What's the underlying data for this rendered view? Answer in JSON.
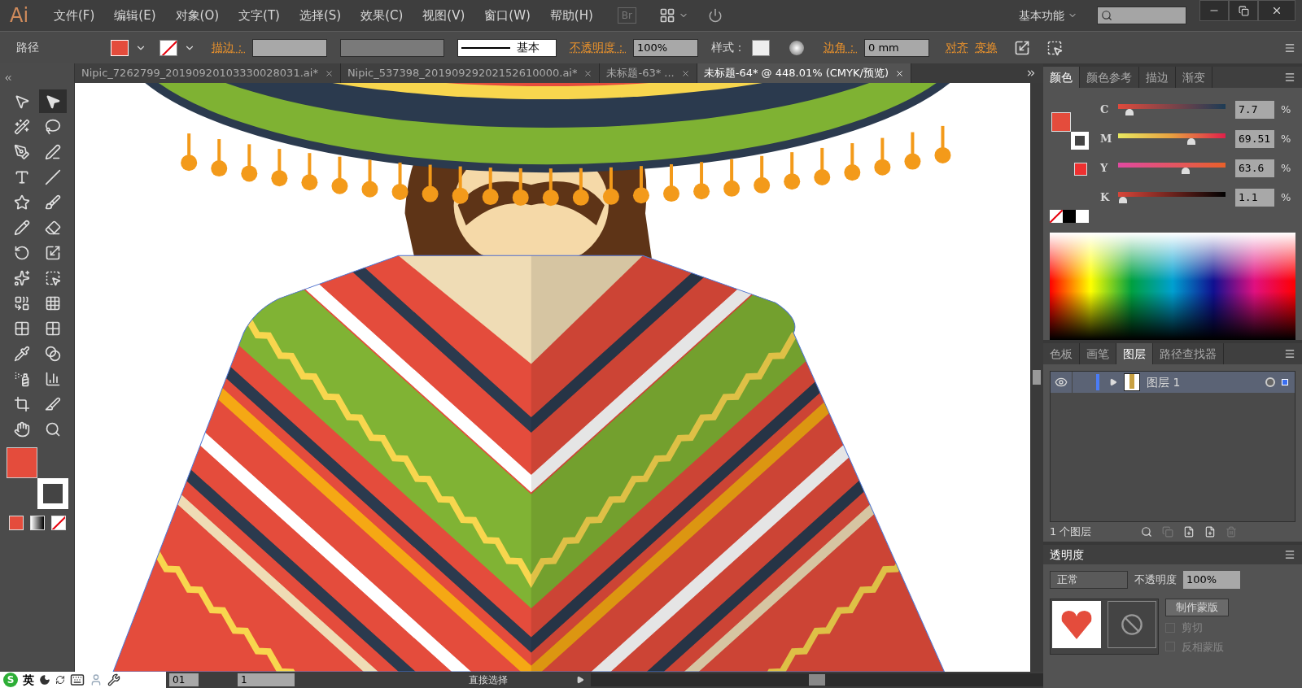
{
  "app_logo": "Ai",
  "menu": [
    "文件(F)",
    "编辑(E)",
    "对象(O)",
    "文字(T)",
    "选择(S)",
    "效果(C)",
    "视图(V)",
    "窗口(W)",
    "帮助(H)"
  ],
  "bridge_label": "Br",
  "workspace": "基本功能",
  "control_bar": {
    "object_type": "路径",
    "stroke_label": "描边：",
    "stroke_style": "基本",
    "opacity_label": "不透明度：",
    "opacity": "100%",
    "style_label": "样式：",
    "corner_label": "边角：",
    "corner_value": "0 mm",
    "align": "对齐",
    "transform": "变换"
  },
  "tabs": [
    {
      "label": "Nipic_7262799_20190920103330028031.ai*",
      "selected": false
    },
    {
      "label": "Nipic_537398_20190929202152610000.ai*",
      "selected": false
    },
    {
      "label": "未标题-63* ...",
      "selected": false
    },
    {
      "label": "未标题-64* @ 448.01% (CMYK/预览)",
      "selected": true
    }
  ],
  "tools": [
    {
      "kind": "select",
      "selected": false
    },
    {
      "kind": "direct",
      "selected": true
    },
    {
      "kind": "wand",
      "selected": false
    },
    {
      "kind": "lasso",
      "selected": false
    },
    {
      "kind": "pen",
      "selected": false
    },
    {
      "kind": "curvature",
      "selected": false
    },
    {
      "kind": "type",
      "selected": false
    },
    {
      "kind": "line",
      "selected": false
    },
    {
      "kind": "star",
      "selected": false
    },
    {
      "kind": "brush",
      "selected": false
    },
    {
      "kind": "pencil",
      "selected": false
    },
    {
      "kind": "eraser",
      "selected": false
    },
    {
      "kind": "rotate",
      "selected": false
    },
    {
      "kind": "scale",
      "selected": false
    },
    {
      "kind": "warp",
      "selected": false
    },
    {
      "kind": "freetransform",
      "selected": false
    },
    {
      "kind": "shapebuilder",
      "selected": false
    },
    {
      "kind": "perspective",
      "selected": false
    },
    {
      "kind": "mesh",
      "selected": false
    },
    {
      "kind": "gradient",
      "selected": false
    },
    {
      "kind": "eyedropper",
      "selected": false
    },
    {
      "kind": "blend",
      "selected": false
    },
    {
      "kind": "spray",
      "selected": false
    },
    {
      "kind": "graph",
      "selected": false
    },
    {
      "kind": "artboard",
      "selected": false
    },
    {
      "kind": "slice",
      "selected": false
    },
    {
      "kind": "hand",
      "selected": false
    },
    {
      "kind": "zoom",
      "selected": false
    }
  ],
  "color_panel": {
    "tabs": [
      {
        "label": "颜色",
        "selected": true
      },
      {
        "label": "颜色参考",
        "selected": false
      },
      {
        "label": "描边",
        "selected": false
      },
      {
        "label": "渐变",
        "selected": false
      }
    ],
    "channels": [
      {
        "name": "C",
        "value": "7.7",
        "unit": "%",
        "level": 0.077
      },
      {
        "name": "M",
        "value": "69.51",
        "unit": "%",
        "level": 0.6951
      },
      {
        "name": "Y",
        "value": "63.6",
        "unit": "%",
        "level": 0.6365
      },
      {
        "name": "K",
        "value": "1.1",
        "unit": "%",
        "level": 0.011
      }
    ]
  },
  "layers_panel": {
    "tabs": [
      {
        "label": "色板",
        "selected": false
      },
      {
        "label": "画笔",
        "selected": false
      },
      {
        "label": "图层",
        "selected": true
      },
      {
        "label": "路径查找器",
        "selected": false
      }
    ],
    "layers": [
      {
        "name": "图层 1",
        "visible": true,
        "expanded": false,
        "color": "#4a7cf7"
      }
    ],
    "count": "1 个图层"
  },
  "transparency_panel": {
    "title": "透明度",
    "blend_mode": "正常",
    "opacity_label": "不透明度",
    "opacity": "100%",
    "mask_button": "制作蒙版",
    "options": [
      {
        "label": "剪切",
        "checked": false,
        "disabled": true
      },
      {
        "label": "反相蒙版",
        "checked": false,
        "disabled": true
      }
    ]
  },
  "status_bar": {
    "zoom": "01",
    "page": "1",
    "tool": "直接选择"
  },
  "ime_bar": {
    "logo": "S",
    "language": "英"
  }
}
